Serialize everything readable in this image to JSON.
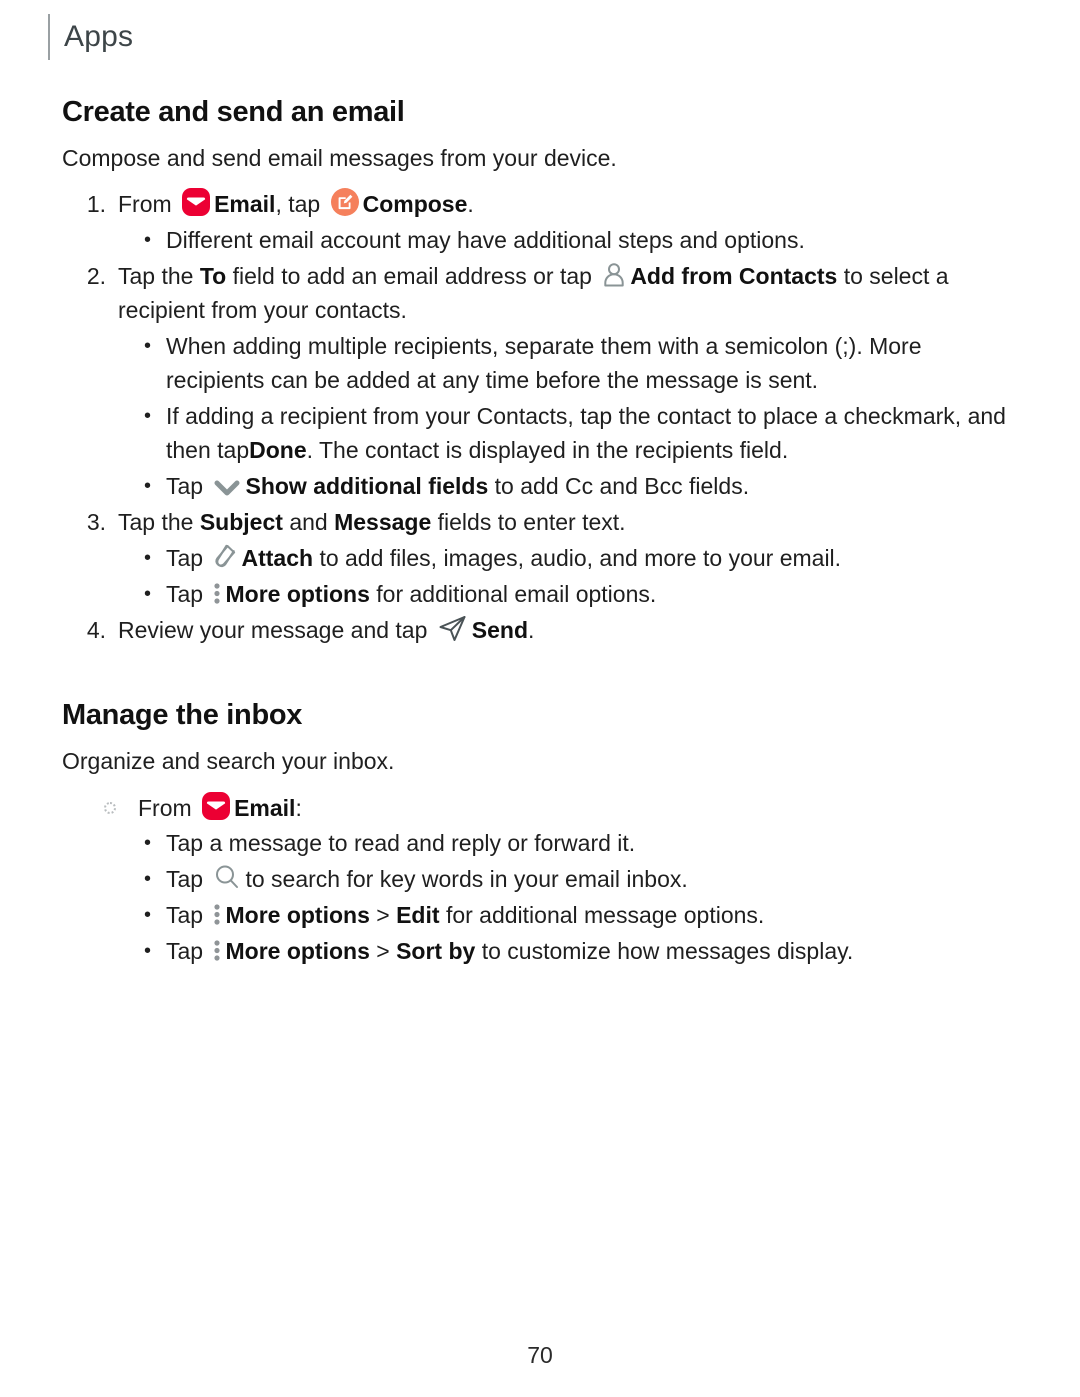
{
  "header": {
    "title": "Apps"
  },
  "sections": [
    {
      "id": "create-send-email",
      "title": "Create and send an email",
      "lead": "Compose and send email messages from your device."
    },
    {
      "id": "manage-inbox",
      "title": "Manage the inbox",
      "lead": "Organize and search your inbox."
    }
  ],
  "steps": {
    "one": {
      "number": "1.",
      "pre": "From",
      "mid": "Email",
      "tap": ", tap",
      "post": "Compose",
      "end": ".",
      "sub": [
        "Different email account may have additional steps and options."
      ]
    },
    "two": {
      "number": "2.",
      "a": "Tap the",
      "b": "To",
      "c": "field to add an email address or tap",
      "d": "Add from Contacts",
      "e": "to select a recipient from your contacts.",
      "sub": [
        "When adding multiple recipients, separate them with a semicolon (;). More recipients can be added at any time before the message is sent."
      ],
      "sub2_a": "If adding a recipient from your Contacts, tap the contact to place a checkmark, and then tap",
      "sub2_b": "Done",
      "sub2_c": ". The contact is displayed in the recipients field.",
      "sub3_a": "Tap",
      "sub3_b": "Show additional fields",
      "sub3_c": "to add Cc and Bcc fields."
    },
    "three": {
      "number": "3.",
      "a": "Tap the",
      "b": "Subject",
      "c": "and",
      "d": "Message",
      "e": "fields to enter text.",
      "sub1_a": "Tap",
      "sub1_b": "Attach",
      "sub1_c": "to add files, images, audio, and more to your email.",
      "sub2_a": "Tap",
      "sub2_b": "More options",
      "sub2_c": "for additional email options."
    },
    "four": {
      "number": "4.",
      "a": "Review your message and tap",
      "b": "Send",
      "c": "."
    }
  },
  "inbox": {
    "from_label": "From",
    "email_label": "Email",
    "colon": ":",
    "items": {
      "read": "Tap a message to read and reply or forward it.",
      "search_a": "Tap",
      "search_b": "to search for key words in your email inbox.",
      "edit_a": "Tap",
      "edit_b": "More options",
      "edit_sep": ">",
      "edit_c": "Edit",
      "edit_d": "for additional message options.",
      "sort_a": "Tap",
      "sort_b": "More options",
      "sort_sep": ">",
      "sort_c": "Sort by",
      "sort_d": "to customize how messages display."
    }
  },
  "footer": {
    "page_number": "70"
  },
  "icons": {
    "email": "email-app-icon",
    "compose": "compose-icon",
    "contacts": "person-add-from-contacts-icon",
    "chevron": "chevron-down-icon",
    "attach": "paperclip-attach-icon",
    "more": "more-options-vertical-dots-icon",
    "send": "send-paper-plane-icon",
    "search": "search-magnifier-icon"
  },
  "colors": {
    "email_icon_bg": "#EC0033",
    "compose_icon_bg": "#F5805C",
    "icon_gray": "#8A9496",
    "dots_gray": "#8f9497",
    "header_gray": "#3d4548",
    "rule_gray": "#9aa0a3"
  }
}
